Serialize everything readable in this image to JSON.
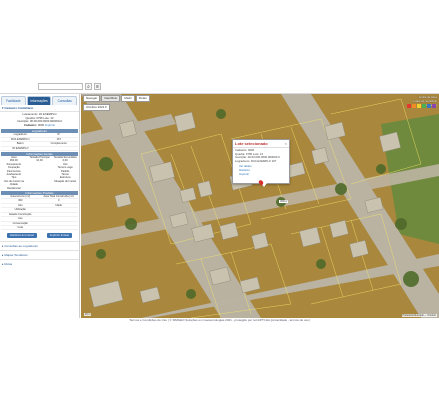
{
  "header": {
    "search_placeholder": "",
    "search_button": "⌕",
    "menu_button": "≡"
  },
  "left_panel": {
    "tabs": [
      {
        "label": "Facilidade"
      },
      {
        "label": "Informações"
      },
      {
        "label": "Consultas"
      }
    ],
    "section_title": "▾ Cadastro Imobiliário",
    "info": {
      "loteamento": "Loteamento: JD EXEMPLO",
      "lote": "Quadra: 0795 Lote: 13",
      "inscricao": "Inscrição: 00.00.000.0000.000000-0",
      "cadastro_label": "Cadastro:",
      "cadastro_value": "0000",
      "cadastro_link": "Imprimir"
    },
    "logradouro": {
      "title": "Logradouro",
      "rows": [
        [
          "Logradouro",
          "Nº"
        ],
        [
          "RUA EXEMPLO",
          "167"
        ],
        [
          "Bairro",
          "Complemento"
        ],
        [
          "JD EXEMPLO",
          ""
        ]
      ]
    },
    "informacoes_title": "Informações Gerais",
    "informacoes": [
      [
        "Área",
        "Testada Principal",
        "Testada Secundária"
      ],
      [
        "360,00",
        "12,00",
        "0,00"
      ],
      [
        "Zoneamento",
        "",
        "Uso"
      ],
      [
        "Ocupação",
        "",
        "Terreno vago"
      ],
      [
        "Pavimentos",
        "",
        "Padrão"
      ],
      [
        "Acabamento",
        "",
        "Térreo"
      ],
      [
        "Tipo",
        "",
        "Estrutura"
      ],
      [
        "Uso do Imóvel na Cidade",
        "",
        "Situação do Imóvel"
      ],
      [
        "Residencial",
        "",
        ""
      ]
    ],
    "construcao_title": "Informações Prediais",
    "construcao": [
      [
        "Área terreno (m²)",
        "Área Total Construída (m²)"
      ],
      [
        "360",
        "0"
      ],
      [
        "Uso",
        "Idade"
      ],
      [
        "Utilização",
        ""
      ],
      [
        "Estado Construção",
        ""
      ],
      [
        "Uso",
        ""
      ],
      [
        "Conservação",
        ""
      ],
      [
        "Cota",
        ""
      ]
    ],
    "buttons": [
      {
        "label": "Histórico do Imóvel"
      },
      {
        "label": "Imprimir Imóvel"
      }
    ],
    "accordions": [
      {
        "label": "▸ Consultas ao Logradouro"
      },
      {
        "label": "▸ Mapas Temáticos"
      },
      {
        "label": "▸ Rotas"
      }
    ]
  },
  "map": {
    "toolbar": [
      {
        "label": "Navegar"
      },
      {
        "label": "Identificar"
      },
      {
        "label": "Medir"
      },
      {
        "label": "Rotas"
      }
    ],
    "basemap_label": "Ortofoto 2021 ▾",
    "legend_lines": [
      "Limite de lotes",
      "Lotes do município",
      "Quadras"
    ],
    "popup": {
      "title": "Lote selecionado",
      "close": "×",
      "lines": [
        "Cadastro: 0000",
        "Quadra: 0795  Lote: 13",
        "Inscrição: 00.00.000.0000.000000-0",
        "Logradouro: RUA EXEMPLO 167"
      ],
      "links": [
        "Ver dados",
        "Histórico",
        "Imprimir"
      ]
    },
    "lot_label": "360m²",
    "scale": "20 m",
    "attribution": "Prefeitura Municipal — Ortofoto"
  },
  "footer": {
    "text": "Termos e Condições de Uso  |  © SIMGEO Soluções em Geotecnologias 2021 - protegido por reCAPTCHA (privacidade - termos de uso)"
  },
  "colors": {
    "primary": "#2a5d93",
    "accent_red": "#d9302e",
    "panel_border": "#cfcfcf"
  }
}
